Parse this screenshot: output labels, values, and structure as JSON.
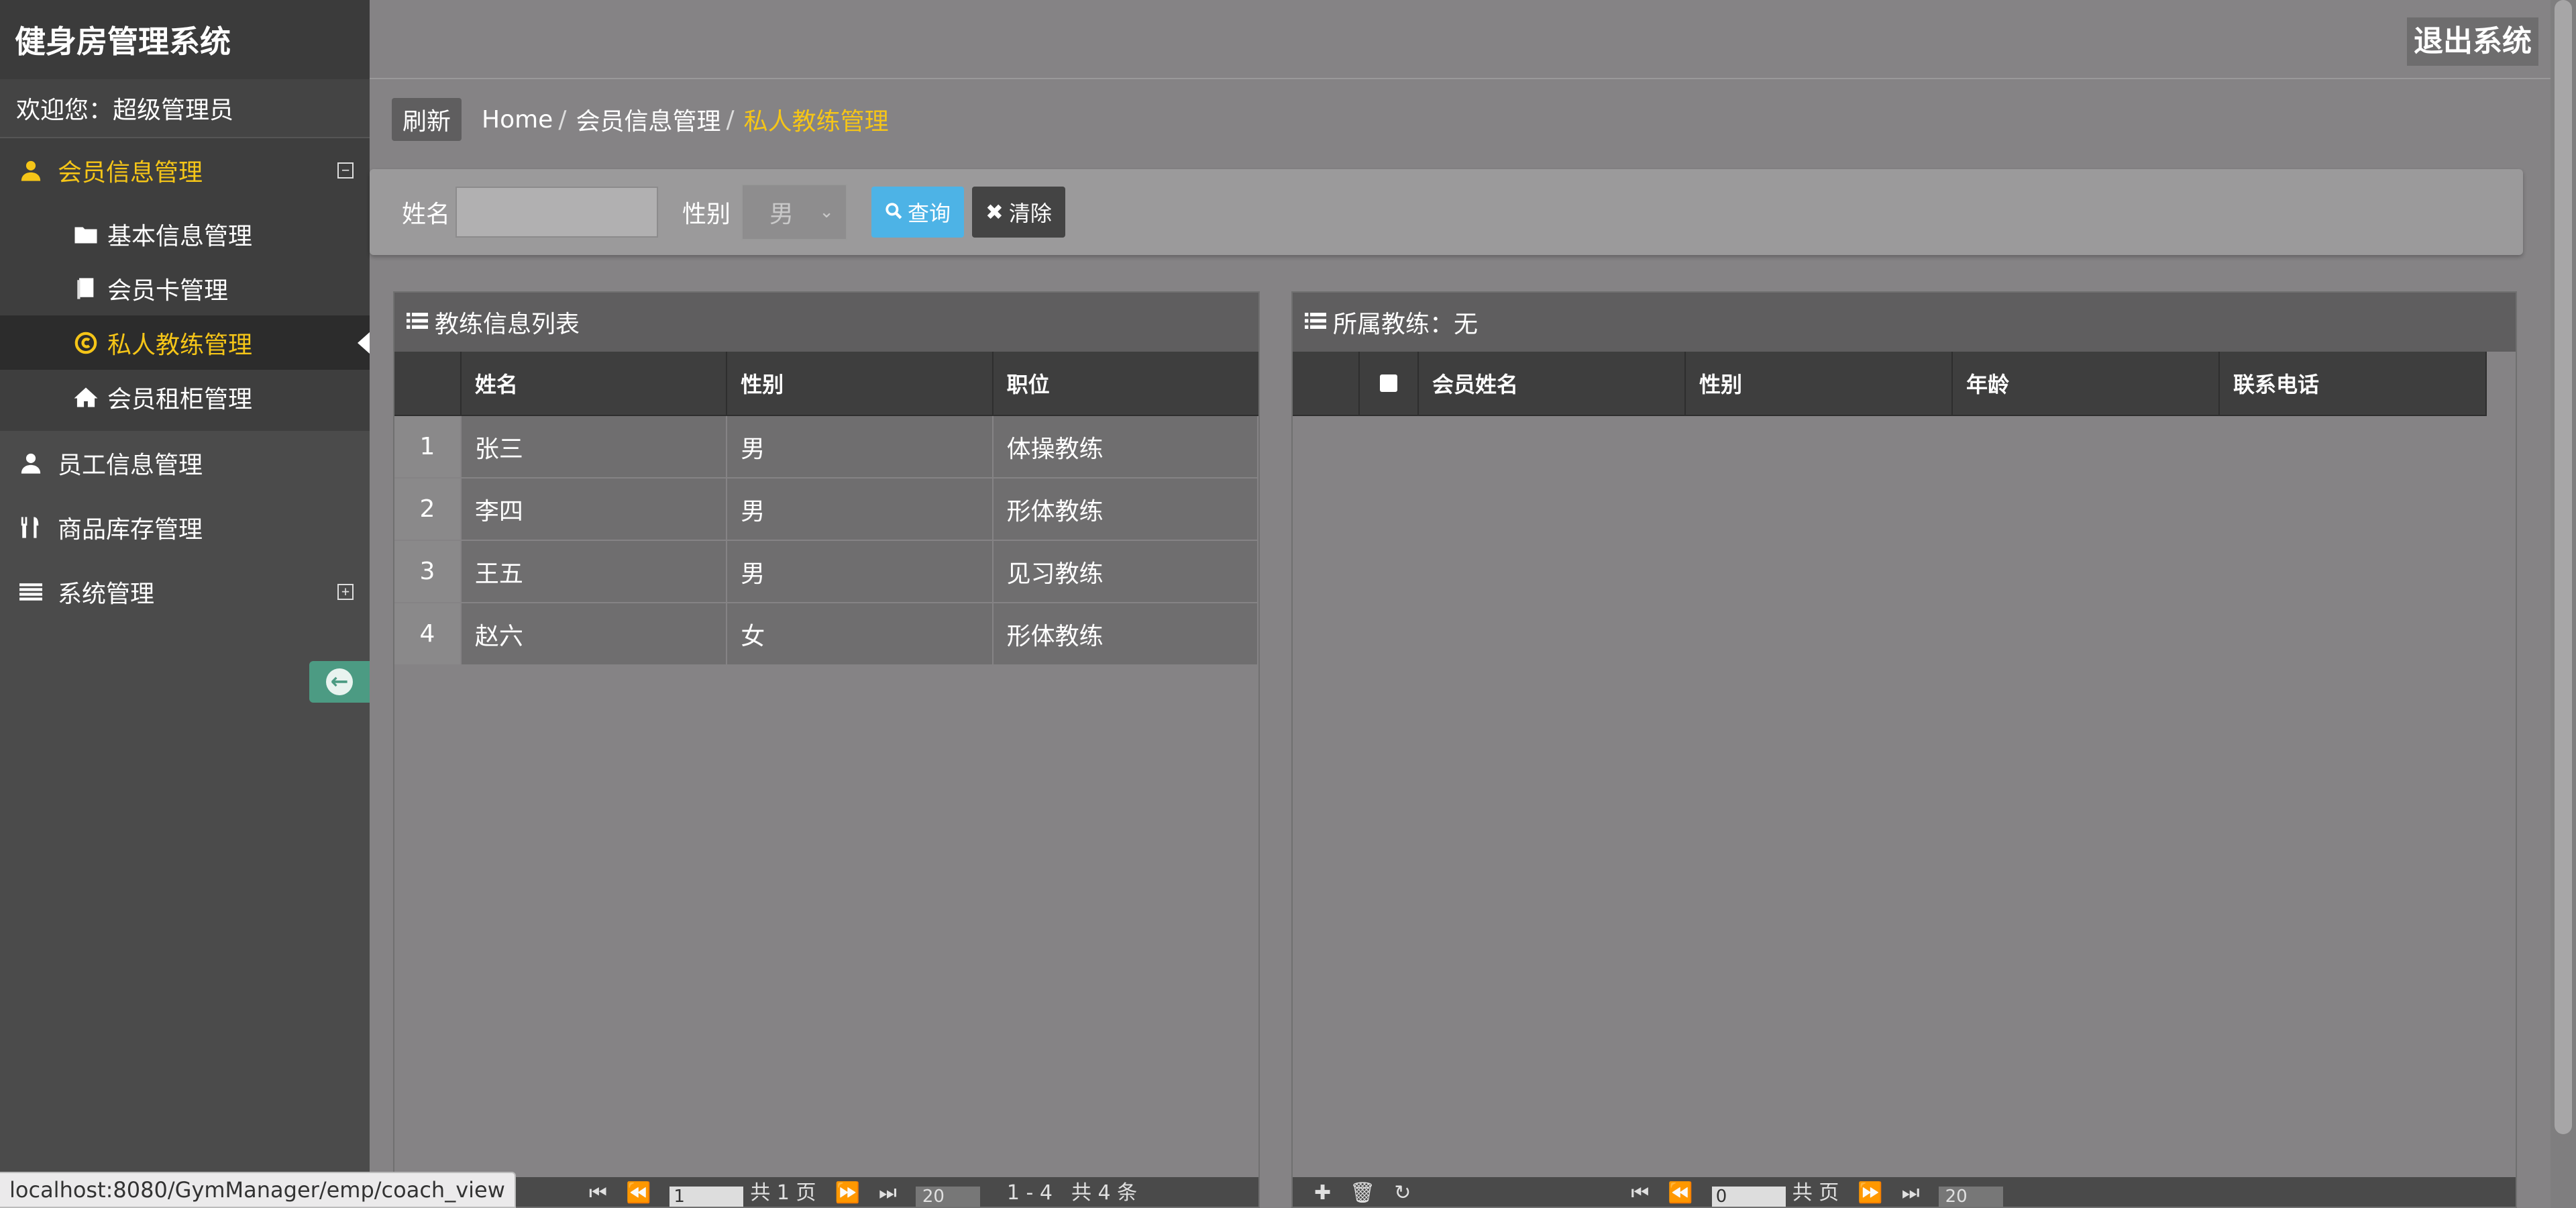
{
  "app": {
    "title": "健身房管理系统",
    "logout_label": "退出系统",
    "welcome": "欢迎您：超级管理员"
  },
  "sidebar": {
    "groups": [
      {
        "label": "会员信息管理",
        "icon": "user-icon",
        "toggle": "⊟",
        "expanded": true
      },
      {
        "label": "员工信息管理",
        "icon": "user-icon"
      },
      {
        "label": "商品库存管理",
        "icon": "utensils-icon"
      },
      {
        "label": "系统管理",
        "icon": "list-icon",
        "toggle": "⊞"
      }
    ],
    "member_sub": [
      {
        "label": "基本信息管理",
        "icon": "folder-icon"
      },
      {
        "label": "会员卡管理",
        "icon": "book-icon"
      },
      {
        "label": "私人教练管理",
        "icon": "copyright-icon",
        "active": true
      },
      {
        "label": "会员租柜管理",
        "icon": "home-icon"
      }
    ],
    "collapse_icon": "arrow-circle-left-icon"
  },
  "breadcrumb": {
    "refresh": "刷新",
    "home": "Home",
    "level1": "会员信息管理",
    "current": "私人教练管理",
    "sep": "/"
  },
  "search": {
    "name_label": "姓名",
    "name_value": "",
    "gender_label": "性别",
    "gender_value": "男",
    "query_label": "查询",
    "clear_label": "清除"
  },
  "coach_panel": {
    "title": "教练信息列表",
    "columns": [
      "姓名",
      "性别",
      "职位"
    ],
    "rows": [
      {
        "no": "1",
        "name": "张三",
        "gender": "男",
        "position": "体操教练"
      },
      {
        "no": "2",
        "name": "李四",
        "gender": "男",
        "position": "形体教练"
      },
      {
        "no": "3",
        "name": "王五",
        "gender": "男",
        "position": "见习教练"
      },
      {
        "no": "4",
        "name": "赵六",
        "gender": "女",
        "position": "形体教练"
      }
    ],
    "pager": {
      "page": "1",
      "total_pages": "共 1 页",
      "page_size": "20",
      "range": "1 - 4",
      "total": "共 4 条"
    }
  },
  "member_panel": {
    "title": "所属教练：无",
    "columns": [
      "会员姓名",
      "性别",
      "年龄",
      "联系电话"
    ],
    "pager": {
      "page": "0",
      "total_pages": "共 页",
      "page_size": "20"
    }
  },
  "status_url": "localhost:8080/GymManager/emp/coach_view",
  "colors": {
    "accent": "#f5c518",
    "query_button": "#4db3e6",
    "collapse_button": "#4c9b83"
  }
}
